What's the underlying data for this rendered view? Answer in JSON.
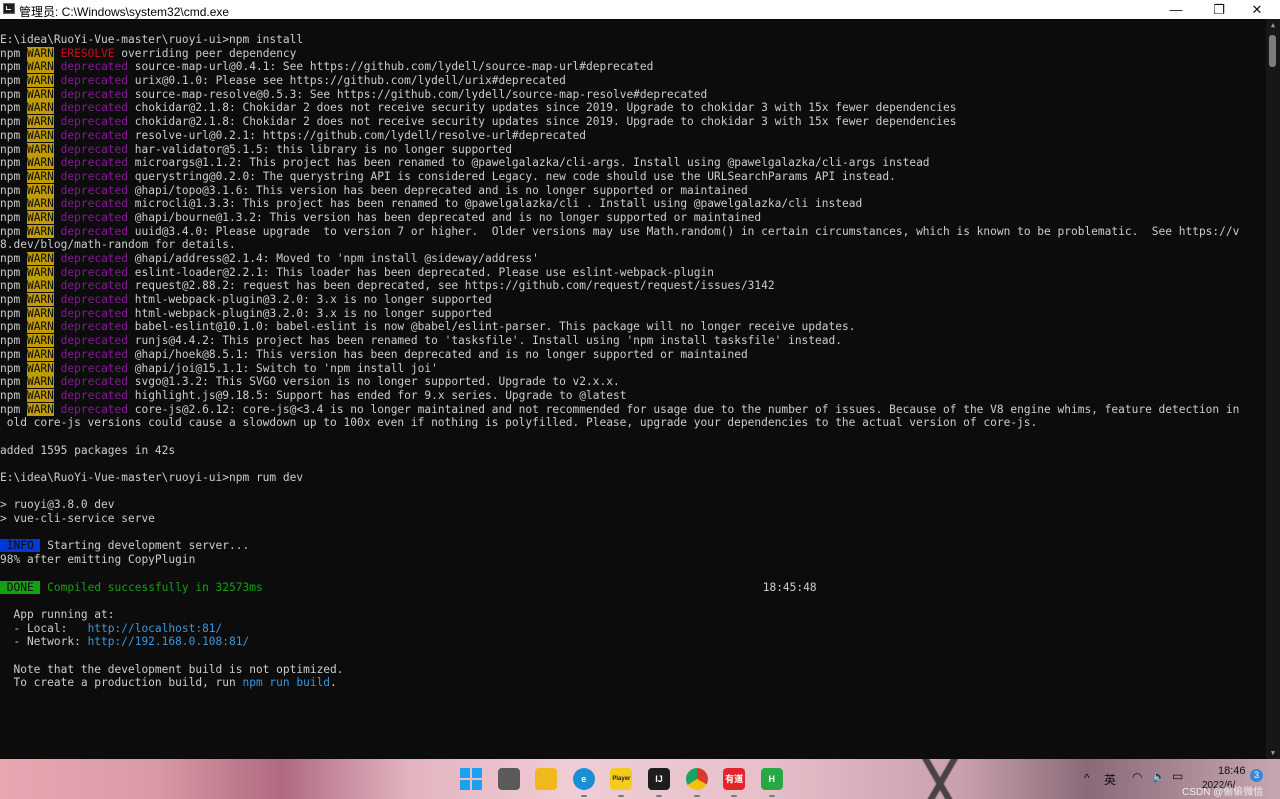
{
  "window": {
    "title": "管理员: C:\\Windows\\system32\\cmd.exe",
    "minimize_glyph": "—",
    "maximize_glyph": "❐",
    "close_glyph": "✕"
  },
  "console": {
    "lines": [
      [
        {
          "t": "E:\\idea\\RuoYi-Vue-master\\ruoyi-ui>npm install"
        }
      ],
      [
        {
          "t": "npm "
        },
        {
          "t": "WARN",
          "c": "warn"
        },
        {
          "t": " "
        },
        {
          "t": "ERESOLVE",
          "c": "eresolve"
        },
        {
          "t": " overriding peer dependency"
        }
      ],
      [
        {
          "t": "npm "
        },
        {
          "t": "WARN",
          "c": "warn"
        },
        {
          "t": " "
        },
        {
          "t": "deprecated",
          "c": "dep"
        },
        {
          "t": " source-map-url@0.4.1: See https://github.com/lydell/source-map-url#deprecated"
        }
      ],
      [
        {
          "t": "npm "
        },
        {
          "t": "WARN",
          "c": "warn"
        },
        {
          "t": " "
        },
        {
          "t": "deprecated",
          "c": "dep"
        },
        {
          "t": " urix@0.1.0: Please see https://github.com/lydell/urix#deprecated"
        }
      ],
      [
        {
          "t": "npm "
        },
        {
          "t": "WARN",
          "c": "warn"
        },
        {
          "t": " "
        },
        {
          "t": "deprecated",
          "c": "dep"
        },
        {
          "t": " source-map-resolve@0.5.3: See https://github.com/lydell/source-map-resolve#deprecated"
        }
      ],
      [
        {
          "t": "npm "
        },
        {
          "t": "WARN",
          "c": "warn"
        },
        {
          "t": " "
        },
        {
          "t": "deprecated",
          "c": "dep"
        },
        {
          "t": " chokidar@2.1.8: Chokidar 2 does not receive security updates since 2019. Upgrade to chokidar 3 with 15x fewer dependencies"
        }
      ],
      [
        {
          "t": "npm "
        },
        {
          "t": "WARN",
          "c": "warn"
        },
        {
          "t": " "
        },
        {
          "t": "deprecated",
          "c": "dep"
        },
        {
          "t": " chokidar@2.1.8: Chokidar 2 does not receive security updates since 2019. Upgrade to chokidar 3 with 15x fewer dependencies"
        }
      ],
      [
        {
          "t": "npm "
        },
        {
          "t": "WARN",
          "c": "warn"
        },
        {
          "t": " "
        },
        {
          "t": "deprecated",
          "c": "dep"
        },
        {
          "t": " resolve-url@0.2.1: https://github.com/lydell/resolve-url#deprecated"
        }
      ],
      [
        {
          "t": "npm "
        },
        {
          "t": "WARN",
          "c": "warn"
        },
        {
          "t": " "
        },
        {
          "t": "deprecated",
          "c": "dep"
        },
        {
          "t": " har-validator@5.1.5: this library is no longer supported"
        }
      ],
      [
        {
          "t": "npm "
        },
        {
          "t": "WARN",
          "c": "warn"
        },
        {
          "t": " "
        },
        {
          "t": "deprecated",
          "c": "dep"
        },
        {
          "t": " microargs@1.1.2: This project has been renamed to @pawelgalazka/cli-args. Install using @pawelgalazka/cli-args instead"
        }
      ],
      [
        {
          "t": "npm "
        },
        {
          "t": "WARN",
          "c": "warn"
        },
        {
          "t": " "
        },
        {
          "t": "deprecated",
          "c": "dep"
        },
        {
          "t": " querystring@0.2.0: The querystring API is considered Legacy. new code should use the URLSearchParams API instead."
        }
      ],
      [
        {
          "t": "npm "
        },
        {
          "t": "WARN",
          "c": "warn"
        },
        {
          "t": " "
        },
        {
          "t": "deprecated",
          "c": "dep"
        },
        {
          "t": " @hapi/topo@3.1.6: This version has been deprecated and is no longer supported or maintained"
        }
      ],
      [
        {
          "t": "npm "
        },
        {
          "t": "WARN",
          "c": "warn"
        },
        {
          "t": " "
        },
        {
          "t": "deprecated",
          "c": "dep"
        },
        {
          "t": " microcli@1.3.3: This project has been renamed to @pawelgalazka/cli . Install using @pawelgalazka/cli instead"
        }
      ],
      [
        {
          "t": "npm "
        },
        {
          "t": "WARN",
          "c": "warn"
        },
        {
          "t": " "
        },
        {
          "t": "deprecated",
          "c": "dep"
        },
        {
          "t": " @hapi/bourne@1.3.2: This version has been deprecated and is no longer supported or maintained"
        }
      ],
      [
        {
          "t": "npm "
        },
        {
          "t": "WARN",
          "c": "warn"
        },
        {
          "t": " "
        },
        {
          "t": "deprecated",
          "c": "dep"
        },
        {
          "t": " uuid@3.4.0: Please upgrade  to version 7 or higher.  Older versions may use Math.random() in certain circumstances, which is known to be problematic.  See https://v"
        }
      ],
      [
        {
          "t": "8.dev/blog/math-random for details."
        }
      ],
      [
        {
          "t": "npm "
        },
        {
          "t": "WARN",
          "c": "warn"
        },
        {
          "t": " "
        },
        {
          "t": "deprecated",
          "c": "dep"
        },
        {
          "t": " @hapi/address@2.1.4: Moved to 'npm install @sideway/address'"
        }
      ],
      [
        {
          "t": "npm "
        },
        {
          "t": "WARN",
          "c": "warn"
        },
        {
          "t": " "
        },
        {
          "t": "deprecated",
          "c": "dep"
        },
        {
          "t": " eslint-loader@2.2.1: This loader has been deprecated. Please use eslint-webpack-plugin"
        }
      ],
      [
        {
          "t": "npm "
        },
        {
          "t": "WARN",
          "c": "warn"
        },
        {
          "t": " "
        },
        {
          "t": "deprecated",
          "c": "dep"
        },
        {
          "t": " request@2.88.2: request has been deprecated, see https://github.com/request/request/issues/3142"
        }
      ],
      [
        {
          "t": "npm "
        },
        {
          "t": "WARN",
          "c": "warn"
        },
        {
          "t": " "
        },
        {
          "t": "deprecated",
          "c": "dep"
        },
        {
          "t": " html-webpack-plugin@3.2.0: 3.x is no longer supported"
        }
      ],
      [
        {
          "t": "npm "
        },
        {
          "t": "WARN",
          "c": "warn"
        },
        {
          "t": " "
        },
        {
          "t": "deprecated",
          "c": "dep"
        },
        {
          "t": " html-webpack-plugin@3.2.0: 3.x is no longer supported"
        }
      ],
      [
        {
          "t": "npm "
        },
        {
          "t": "WARN",
          "c": "warn"
        },
        {
          "t": " "
        },
        {
          "t": "deprecated",
          "c": "dep"
        },
        {
          "t": " babel-eslint@10.1.0: babel-eslint is now @babel/eslint-parser. This package will no longer receive updates."
        }
      ],
      [
        {
          "t": "npm "
        },
        {
          "t": "WARN",
          "c": "warn"
        },
        {
          "t": " "
        },
        {
          "t": "deprecated",
          "c": "dep"
        },
        {
          "t": " runjs@4.4.2: This project has been renamed to 'tasksfile'. Install using 'npm install tasksfile' instead."
        }
      ],
      [
        {
          "t": "npm "
        },
        {
          "t": "WARN",
          "c": "warn"
        },
        {
          "t": " "
        },
        {
          "t": "deprecated",
          "c": "dep"
        },
        {
          "t": " @hapi/hoek@8.5.1: This version has been deprecated and is no longer supported or maintained"
        }
      ],
      [
        {
          "t": "npm "
        },
        {
          "t": "WARN",
          "c": "warn"
        },
        {
          "t": " "
        },
        {
          "t": "deprecated",
          "c": "dep"
        },
        {
          "t": " @hapi/joi@15.1.1: Switch to 'npm install joi'"
        }
      ],
      [
        {
          "t": "npm "
        },
        {
          "t": "WARN",
          "c": "warn"
        },
        {
          "t": " "
        },
        {
          "t": "deprecated",
          "c": "dep"
        },
        {
          "t": " svgo@1.3.2: This SVGO version is no longer supported. Upgrade to v2.x.x."
        }
      ],
      [
        {
          "t": "npm "
        },
        {
          "t": "WARN",
          "c": "warn"
        },
        {
          "t": " "
        },
        {
          "t": "deprecated",
          "c": "dep"
        },
        {
          "t": " highlight.js@9.18.5: Support has ended for 9.x series. Upgrade to @latest"
        }
      ],
      [
        {
          "t": "npm "
        },
        {
          "t": "WARN",
          "c": "warn"
        },
        {
          "t": " "
        },
        {
          "t": "deprecated",
          "c": "dep"
        },
        {
          "t": " core-js@2.6.12: core-js@<3.4 is no longer maintained and not recommended for usage due to the number of issues. Because of the V8 engine whims, feature detection in"
        }
      ],
      [
        {
          "t": " old core-js versions could cause a slowdown up to 100x even if nothing is polyfilled. Please, upgrade your dependencies to the actual version of core-js."
        }
      ],
      [
        {
          "t": ""
        }
      ],
      [
        {
          "t": "added 1595 packages in 42s"
        }
      ],
      [
        {
          "t": ""
        }
      ],
      [
        {
          "t": "E:\\idea\\RuoYi-Vue-master\\ruoyi-ui>npm rum dev"
        }
      ],
      [
        {
          "t": ""
        }
      ],
      [
        {
          "t": "> ruoyi@3.8.0 dev"
        }
      ],
      [
        {
          "t": "> vue-cli-service serve"
        }
      ],
      [
        {
          "t": ""
        }
      ],
      [
        {
          "t": " INFO ",
          "c": "info"
        },
        {
          "t": " Starting development server..."
        }
      ],
      [
        {
          "t": "98% after emitting CopyPlugin"
        }
      ],
      [
        {
          "t": ""
        }
      ],
      [
        {
          "t": " DONE ",
          "c": "done"
        },
        {
          "t": " "
        },
        {
          "t": "Compiled successfully in 32573ms",
          "c": "green"
        },
        {
          "g": 1
        },
        {
          "t": "18:45:48"
        }
      ],
      [
        {
          "t": ""
        }
      ],
      [
        {
          "t": "  App running at:"
        }
      ],
      [
        {
          "t": "  - Local:   "
        },
        {
          "t": "http://localhost:81/",
          "c": "link"
        }
      ],
      [
        {
          "t": "  - Network: "
        },
        {
          "t": "http://192.168.0.108:81/",
          "c": "link"
        }
      ],
      [
        {
          "t": ""
        }
      ],
      [
        {
          "t": "  Note that the development build is not optimized."
        }
      ],
      [
        {
          "t": "  To create a production build, run "
        },
        {
          "t": "npm run build",
          "c": "link"
        },
        {
          "t": "."
        }
      ]
    ]
  },
  "scrollbar": {
    "up_glyph": "▲",
    "down_glyph": "▼"
  },
  "taskbar": {
    "icons": [
      {
        "name": "windows-start-icon",
        "label": "",
        "color": "#0a7fd8"
      },
      {
        "name": "task-view-icon",
        "label": "",
        "color": "#5a5a5a"
      },
      {
        "name": "file-explorer-icon",
        "label": "",
        "color": "#f1b81c"
      },
      {
        "name": "edge-browser-icon",
        "label": "e",
        "color": "#1b8fd6"
      },
      {
        "name": "potplayer-icon",
        "label": "Player",
        "color": "#f4cc1e"
      },
      {
        "name": "jetbrains-icon",
        "label": "IJ",
        "color": "#1d1d1d"
      },
      {
        "name": "chrome-icon",
        "label": "",
        "color": "#d93a30"
      },
      {
        "name": "youdao-dict-icon",
        "label": "有道",
        "color": "#e4232a"
      },
      {
        "name": "hbuilder-icon",
        "label": "H",
        "color": "#26a845"
      }
    ],
    "tray": {
      "chevron": "^",
      "ime": "英",
      "wifi_glyph": "◠",
      "volume_glyph": "🔈",
      "battery_glyph": "▭",
      "time": "18:46",
      "date": "2022/6/",
      "notification_count": "3",
      "watermark": "CSDN @偷偷微信"
    }
  }
}
